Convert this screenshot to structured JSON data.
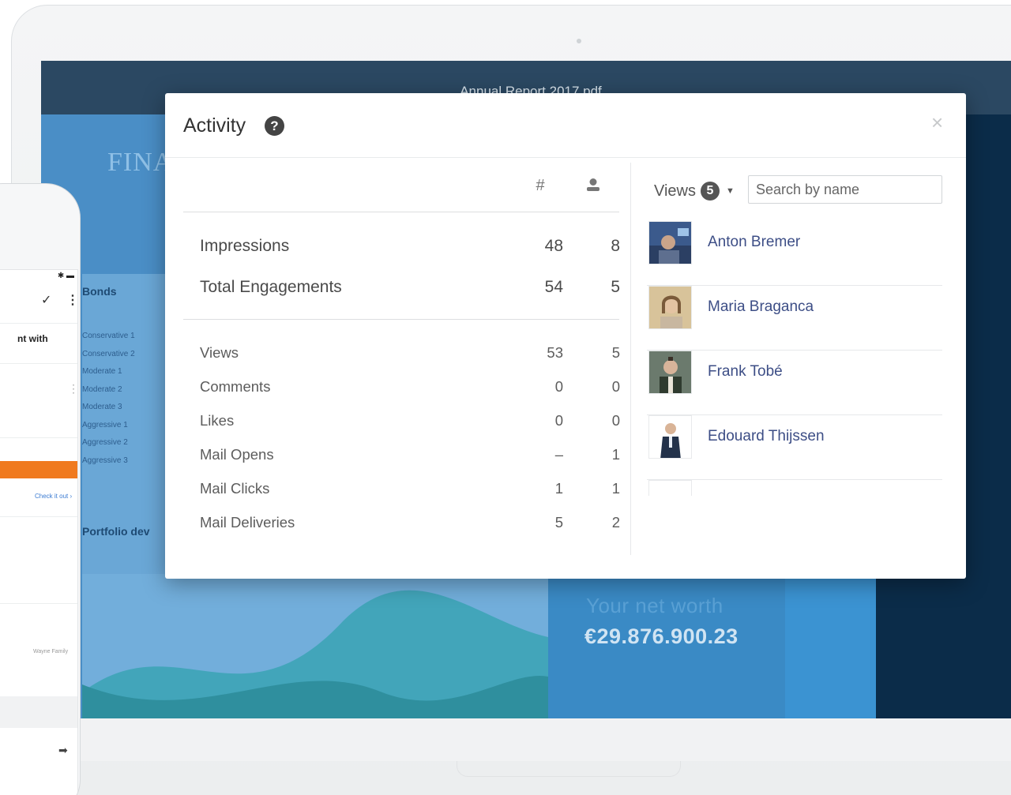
{
  "document": {
    "filename": "Annual Report 2017.pdf",
    "left_title": "FINA",
    "bonds_title": "Bonds",
    "bond_items": [
      "Conservative 1",
      "Conservative 2",
      "Moderate 1",
      "Moderate 2",
      "Moderate 3",
      "Aggressive 1",
      "Aggressive 2",
      "Aggressive 3"
    ],
    "portfolio_title": "Portfolio dev",
    "networth_label": "Your net worth",
    "networth_value": "€29.876.900.23"
  },
  "phone": {
    "text_line": "nt with",
    "link_text": "Check it out  ›",
    "footer_text": "Wayne Family"
  },
  "modal": {
    "title": "Activity",
    "help_icon": "?",
    "close_icon": "×",
    "columns": {
      "count_header": "#",
      "users_icon": "user-icon"
    },
    "summary_rows": [
      {
        "label": "Impressions",
        "count": "48",
        "users": "8"
      },
      {
        "label": "Total Engagements",
        "count": "54",
        "users": "5"
      }
    ],
    "detail_rows": [
      {
        "label": "Views",
        "count": "53",
        "users": "5"
      },
      {
        "label": "Comments",
        "count": "0",
        "users": "0"
      },
      {
        "label": "Likes",
        "count": "0",
        "users": "0"
      },
      {
        "label": "Mail Opens",
        "count": "–",
        "users": "1"
      },
      {
        "label": "Mail Clicks",
        "count": "1",
        "users": "1"
      },
      {
        "label": "Mail Deliveries",
        "count": "5",
        "users": "2"
      }
    ],
    "filter": {
      "label": "Views",
      "badge": "5"
    },
    "search": {
      "placeholder": "Search by name",
      "value": ""
    },
    "people": [
      {
        "name": "Anton Bremer"
      },
      {
        "name": "Maria Braganca"
      },
      {
        "name": "Frank Tobé"
      },
      {
        "name": "Edouard Thijssen"
      }
    ]
  },
  "colors": {
    "accent_name": "#3d4e86",
    "doc_header": "#2b4862",
    "doc_dark": "#0b2c49",
    "phone_banner": "#f07a1f"
  }
}
